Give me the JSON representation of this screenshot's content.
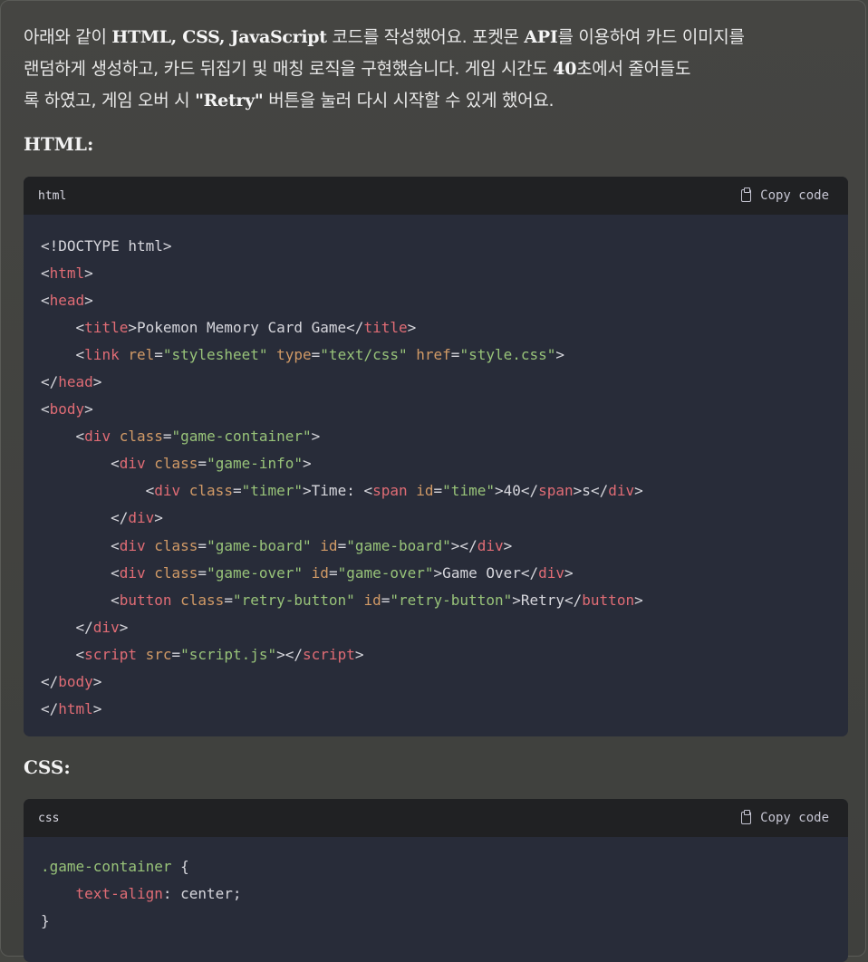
{
  "intro": {
    "line1": [
      {
        "t": "아래와 같이 ",
        "b": false
      },
      {
        "t": "HTML, CSS, JavaScript",
        "b": true
      },
      {
        "t": " 코드를 작성했어요. 포켓몬 ",
        "b": false
      },
      {
        "t": "API",
        "b": true
      },
      {
        "t": "를 이용하여 카드 이미지를",
        "b": false
      }
    ],
    "line2": [
      {
        "t": "랜덤하게 생성하고, 카드 뒤집기 및 매칭 로직을 구현했습니다. 게임 시간도 ",
        "b": false
      },
      {
        "t": "40",
        "b": true
      },
      {
        "t": "초에서 줄어들도",
        "b": false
      }
    ],
    "line3": [
      {
        "t": "록 하였고, 게임 오버 시 ",
        "b": false
      },
      {
        "t": "\"Retry\"",
        "b": true
      },
      {
        "t": " 버튼을 눌러 다시 시작할 수 있게 했어요.",
        "b": false
      }
    ]
  },
  "html_section": {
    "title": "HTML:",
    "lang": "html",
    "copy_label": "Copy code",
    "lines": [
      [
        [
          "p",
          "<!DOCTYPE html>"
        ]
      ],
      [
        [
          "p",
          "<"
        ],
        [
          "t",
          "html"
        ],
        [
          "p",
          ">"
        ]
      ],
      [
        [
          "p",
          "<"
        ],
        [
          "t",
          "head"
        ],
        [
          "p",
          ">"
        ]
      ],
      [
        [
          "p",
          "    <"
        ],
        [
          "t",
          "title"
        ],
        [
          "p",
          ">Pokemon Memory Card Game</"
        ],
        [
          "t",
          "title"
        ],
        [
          "p",
          ">"
        ]
      ],
      [
        [
          "p",
          "    <"
        ],
        [
          "t",
          "link"
        ],
        [
          "p",
          " "
        ],
        [
          "a",
          "rel"
        ],
        [
          "p",
          "="
        ],
        [
          "s",
          "\"stylesheet\""
        ],
        [
          "p",
          " "
        ],
        [
          "a",
          "type"
        ],
        [
          "p",
          "="
        ],
        [
          "s",
          "\"text/css\""
        ],
        [
          "p",
          " "
        ],
        [
          "a",
          "href"
        ],
        [
          "p",
          "="
        ],
        [
          "s",
          "\"style.css\""
        ],
        [
          "p",
          ">"
        ]
      ],
      [
        [
          "p",
          "</"
        ],
        [
          "t",
          "head"
        ],
        [
          "p",
          ">"
        ]
      ],
      [
        [
          "p",
          "<"
        ],
        [
          "t",
          "body"
        ],
        [
          "p",
          ">"
        ]
      ],
      [
        [
          "p",
          "    <"
        ],
        [
          "t",
          "div"
        ],
        [
          "p",
          " "
        ],
        [
          "a",
          "class"
        ],
        [
          "p",
          "="
        ],
        [
          "s",
          "\"game-container\""
        ],
        [
          "p",
          ">"
        ]
      ],
      [
        [
          "p",
          "        <"
        ],
        [
          "t",
          "div"
        ],
        [
          "p",
          " "
        ],
        [
          "a",
          "class"
        ],
        [
          "p",
          "="
        ],
        [
          "s",
          "\"game-info\""
        ],
        [
          "p",
          ">"
        ]
      ],
      [
        [
          "p",
          "            <"
        ],
        [
          "t",
          "div"
        ],
        [
          "p",
          " "
        ],
        [
          "a",
          "class"
        ],
        [
          "p",
          "="
        ],
        [
          "s",
          "\"timer\""
        ],
        [
          "p",
          ">Time: <"
        ],
        [
          "t",
          "span"
        ],
        [
          "p",
          " "
        ],
        [
          "a",
          "id"
        ],
        [
          "p",
          "="
        ],
        [
          "s",
          "\"time\""
        ],
        [
          "p",
          ">40</"
        ],
        [
          "t",
          "span"
        ],
        [
          "p",
          ">s</"
        ],
        [
          "t",
          "div"
        ],
        [
          "p",
          ">"
        ]
      ],
      [
        [
          "p",
          "        </"
        ],
        [
          "t",
          "div"
        ],
        [
          "p",
          ">"
        ]
      ],
      [
        [
          "p",
          "        <"
        ],
        [
          "t",
          "div"
        ],
        [
          "p",
          " "
        ],
        [
          "a",
          "class"
        ],
        [
          "p",
          "="
        ],
        [
          "s",
          "\"game-board\""
        ],
        [
          "p",
          " "
        ],
        [
          "a",
          "id"
        ],
        [
          "p",
          "="
        ],
        [
          "s",
          "\"game-board\""
        ],
        [
          "p",
          "></"
        ],
        [
          "t",
          "div"
        ],
        [
          "p",
          ">"
        ]
      ],
      [
        [
          "p",
          "        <"
        ],
        [
          "t",
          "div"
        ],
        [
          "p",
          " "
        ],
        [
          "a",
          "class"
        ],
        [
          "p",
          "="
        ],
        [
          "s",
          "\"game-over\""
        ],
        [
          "p",
          " "
        ],
        [
          "a",
          "id"
        ],
        [
          "p",
          "="
        ],
        [
          "s",
          "\"game-over\""
        ],
        [
          "p",
          ">Game Over</"
        ],
        [
          "t",
          "div"
        ],
        [
          "p",
          ">"
        ]
      ],
      [
        [
          "p",
          "        <"
        ],
        [
          "t",
          "button"
        ],
        [
          "p",
          " "
        ],
        [
          "a",
          "class"
        ],
        [
          "p",
          "="
        ],
        [
          "s",
          "\"retry-button\""
        ],
        [
          "p",
          " "
        ],
        [
          "a",
          "id"
        ],
        [
          "p",
          "="
        ],
        [
          "s",
          "\"retry-button\""
        ],
        [
          "p",
          ">Retry</"
        ],
        [
          "t",
          "button"
        ],
        [
          "p",
          ">"
        ]
      ],
      [
        [
          "p",
          "    </"
        ],
        [
          "t",
          "div"
        ],
        [
          "p",
          ">"
        ]
      ],
      [
        [
          "p",
          "    <"
        ],
        [
          "t",
          "script"
        ],
        [
          "p",
          " "
        ],
        [
          "a",
          "src"
        ],
        [
          "p",
          "="
        ],
        [
          "s",
          "\"script.js\""
        ],
        [
          "p",
          "></"
        ],
        [
          "t",
          "script"
        ],
        [
          "p",
          ">"
        ]
      ],
      [
        [
          "p",
          "</"
        ],
        [
          "t",
          "body"
        ],
        [
          "p",
          ">"
        ]
      ],
      [
        [
          "p",
          "</"
        ],
        [
          "t",
          "html"
        ],
        [
          "p",
          ">"
        ]
      ]
    ]
  },
  "css_section": {
    "title": "CSS:",
    "lang": "css",
    "copy_label": "Copy code",
    "lines": [
      [
        [
          "sel",
          ".game-container"
        ],
        [
          "p",
          " {"
        ]
      ],
      [
        [
          "p",
          "    "
        ],
        [
          "prop",
          "text-align"
        ],
        [
          "p",
          ": center;"
        ]
      ],
      [
        [
          "p",
          "}"
        ]
      ]
    ]
  }
}
